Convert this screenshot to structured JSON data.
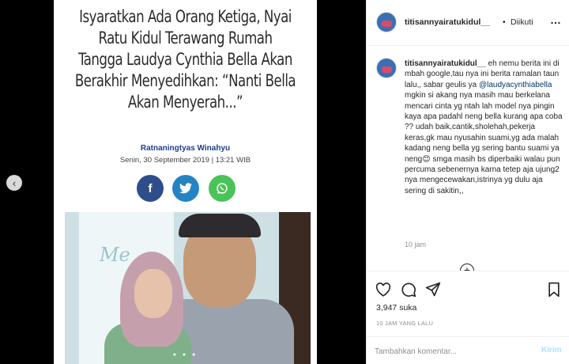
{
  "article": {
    "headline_lines": [
      "Isyaratkan Ada Orang Ketiga, Nyai",
      "Ratu Kidul Terawang Rumah",
      "Tangga Laudya Cynthia Bella Akan",
      "Berakhir Menyedihkan: “Nanti Bella",
      "Akan Menyerah...”"
    ],
    "author": "Ratnaningtyas Winahyu",
    "date": "Senin, 30 September 2019 | 13:21 WIB",
    "share": {
      "facebook": "f",
      "twitter": "t",
      "whatsapp": "○"
    },
    "photo_banner_text": "Me",
    "carousel_dots": "● ● ●"
  },
  "nav": {
    "prev_icon": "chevron-left-icon",
    "prev_glyph": "‹"
  },
  "header": {
    "username": "titisannyairatukidul__",
    "separator": "•",
    "follow_status": "Diikuti",
    "more_glyph": "…"
  },
  "caption": {
    "username": "titisannyairatukidul__",
    "text_before_mention": " eh nemu berita ini di mbah google,tau nya ini berita ramalan taun lalu,, sabar geulis ya ",
    "mention": "@laudyacynthiabella",
    "text_after_mention": " mgkin si akang nya masih mau berkelana mencari cinta yg ntah lah model nya pingin kaya apa padahl neng bella kurang apa coba ?? udah baik,cantik,sholehah,pekerja keras,gk mau nyusahin suami,yg ada malah kadang neng bella yg sering bantu suami ya neng😊 smga masih bs diperbaiki walau pun percuma sebenernya karna tetep aja ujung2 nya mengecewakan,istrinya yg dulu aja sering di sakitin,,",
    "time": "10 jam"
  },
  "load_more_glyph": "+",
  "actions": {
    "likes": "3,947 suka",
    "timestamp": "10 JAM YANG LALU",
    "comment_placeholder": "Tambahkan komentar...",
    "post_label": "Kirim"
  },
  "colors": {
    "accent_link": "#00376b",
    "post_disabled": "#b2dffc",
    "author_blue": "#1e3f8a",
    "facebook": "#2e4d8a",
    "twitter": "#2583c4",
    "whatsapp": "#4ac45a"
  }
}
